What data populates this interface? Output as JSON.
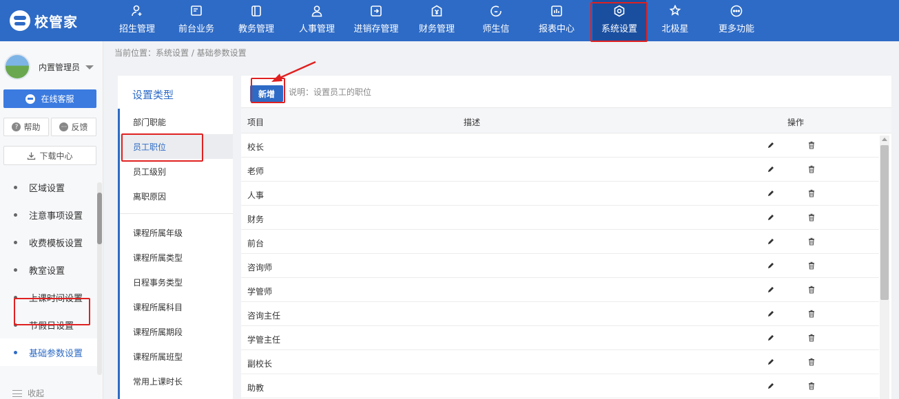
{
  "app": {
    "name": "校管家"
  },
  "nav": {
    "items": [
      {
        "label": "招生管理",
        "icon": "user-add-icon"
      },
      {
        "label": "前台业务",
        "icon": "monitor-icon"
      },
      {
        "label": "教务管理",
        "icon": "book-icon"
      },
      {
        "label": "人事管理",
        "icon": "person-icon"
      },
      {
        "label": "进销存管理",
        "icon": "inventory-icon"
      },
      {
        "label": "财务管理",
        "icon": "yen-shield-icon"
      },
      {
        "label": "师生信",
        "icon": "chat-icon"
      },
      {
        "label": "报表中心",
        "icon": "bar-chart-icon"
      },
      {
        "label": "系统设置",
        "icon": "gear-icon"
      },
      {
        "label": "北极星",
        "icon": "star-icon"
      },
      {
        "label": "更多功能",
        "icon": "more-icon"
      }
    ],
    "active": "系统设置"
  },
  "user": {
    "name": "内置管理员"
  },
  "sidebar": {
    "service_label": "在线客服",
    "help_label": "帮助",
    "feedback_label": "反馈",
    "download_label": "下载中心",
    "menu": [
      "区域设置",
      "注意事项设置",
      "收费模板设置",
      "教室设置",
      "上课时间设置",
      "节假日设置",
      "基础参数设置"
    ],
    "active_menu": "基础参数设置",
    "collapse_label": "收起"
  },
  "breadcrumb": "当前位置：系统设置 / 基础参数设置",
  "categories": {
    "title": "设置类型",
    "group1": [
      "部门职能",
      "员工职位",
      "员工级别",
      "离职原因"
    ],
    "group2": [
      "课程所属年级",
      "课程所属类型",
      "日程事务类型",
      "课程所属科目",
      "课程所属期段",
      "课程所属班型",
      "常用上课时长"
    ],
    "active": "员工职位"
  },
  "main": {
    "add_label": "新增",
    "description": "说明：设置员工的职位",
    "columns": {
      "item": "项目",
      "desc": "描述",
      "action": "操作"
    },
    "rows": [
      "校长",
      "老师",
      "人事",
      "财务",
      "前台",
      "咨询师",
      "学管师",
      "咨询主任",
      "学管主任",
      "副校长",
      "助教"
    ]
  },
  "colors": {
    "primary": "#2e6bc6",
    "highlight": "#e02020",
    "nav_active": "#1a4fa0"
  }
}
